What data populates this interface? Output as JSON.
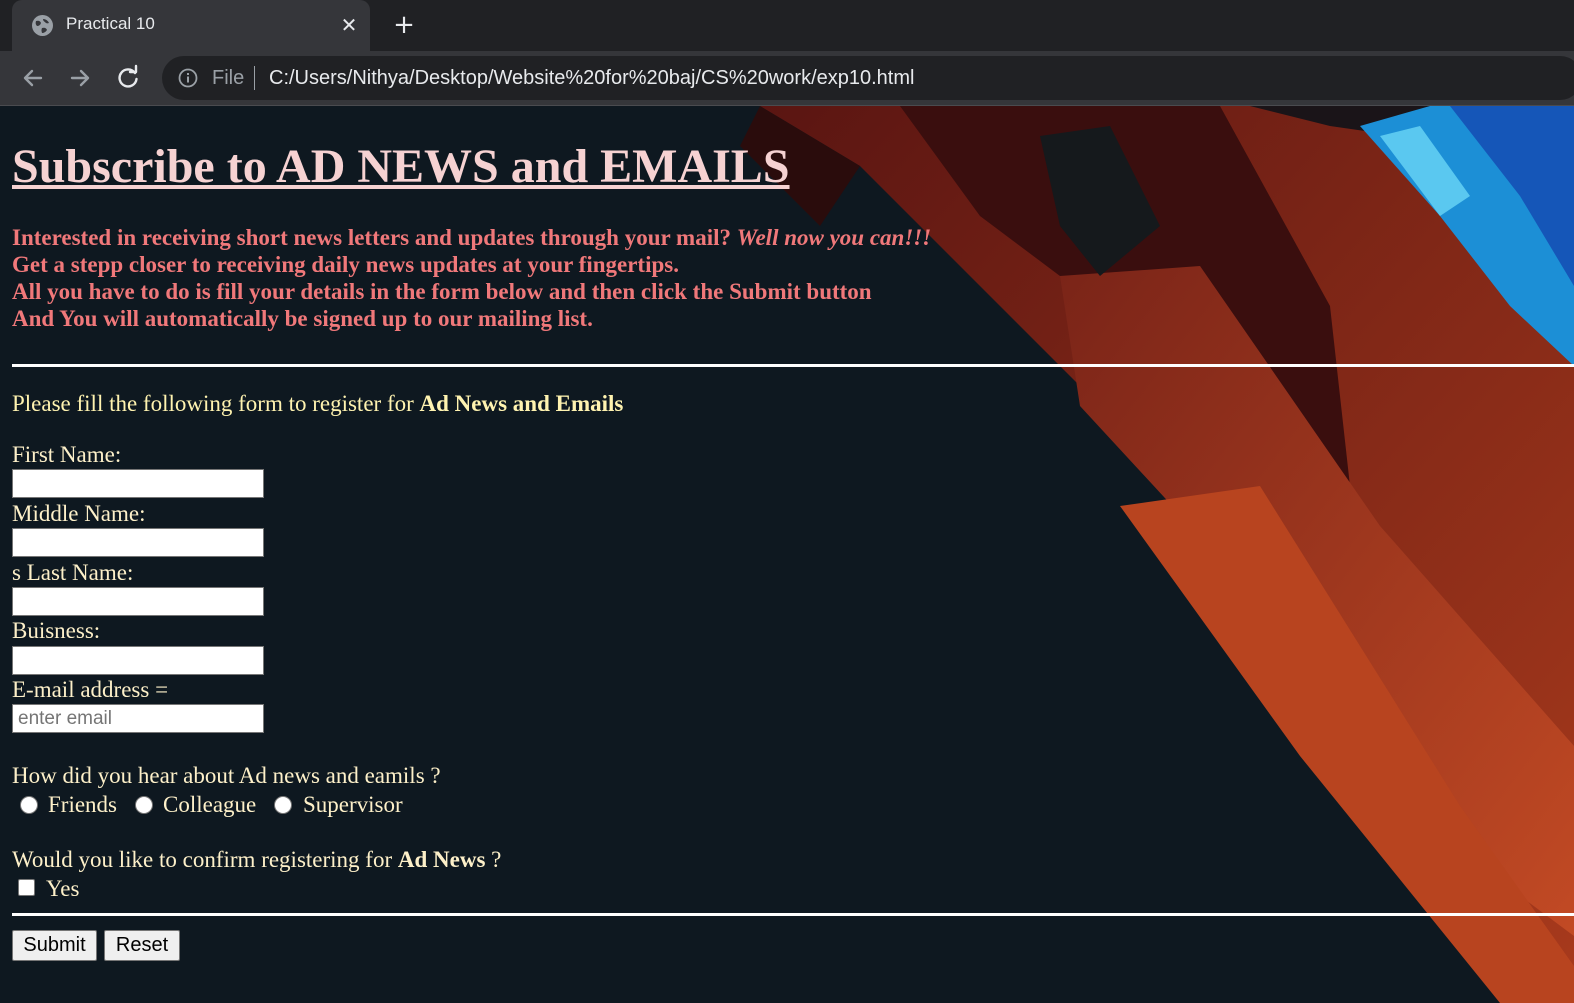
{
  "browser": {
    "tab_title": "Practical 10",
    "new_tab_symbol": "+",
    "close_symbol": "✕",
    "url_scheme": "File",
    "url": "C:/Users/Nithya/Desktop/Website%20for%20baj/CS%20work/exp10.html"
  },
  "page": {
    "heading": "Subscribe to AD NEWS and EMAILS",
    "intro": {
      "line1_a": "Interested in receiving short news letters and updates through your mail?",
      "line1_b": "Well now you can!!!",
      "line2": "Get a stepp closer to receiving daily news updates at your fingertips.",
      "line3": "All you have to do is fill your details in the form below and then click the Submit button",
      "line4": "And You will automatically be signed up to our mailing list."
    },
    "form_intro": {
      "text": "Please fill the following form to register for",
      "bold": "Ad News and Emails"
    },
    "fields": {
      "first_name": {
        "label": "First Name:",
        "value": "",
        "placeholder": ""
      },
      "middle_name": {
        "label": "Middle Name:",
        "value": "",
        "placeholder": ""
      },
      "last_name": {
        "label": "s Last Name:",
        "value": "",
        "placeholder": ""
      },
      "business": {
        "label": "Buisness:",
        "value": "",
        "placeholder": ""
      },
      "email": {
        "label": "E-mail address =",
        "value": "",
        "placeholder": "enter email"
      }
    },
    "hear_about": {
      "question": "How did you hear about Ad news and eamils ?",
      "options": [
        "Friends",
        "Colleague",
        "Supervisor"
      ],
      "selected": null
    },
    "confirm": {
      "question_a": "Would you like to confirm registering for",
      "question_bold": "Ad News",
      "question_b": "?",
      "checkbox_label": "Yes",
      "checked": false
    },
    "buttons": {
      "submit": "Submit",
      "reset": "Reset"
    }
  },
  "colors": {
    "page_bg": "#0e1820",
    "heading": "#f6d2d2",
    "intro_text": "#f0787a",
    "form_text": "#fdf0c9",
    "form_intro_text": "#fff3b0",
    "chrome_dark": "#202124",
    "chrome_tab": "#35363a"
  },
  "icons": {
    "favicon": "globe-icon",
    "back": "arrow-left-icon",
    "forward": "arrow-right-icon",
    "reload": "reload-icon",
    "site_info": "info-icon"
  }
}
